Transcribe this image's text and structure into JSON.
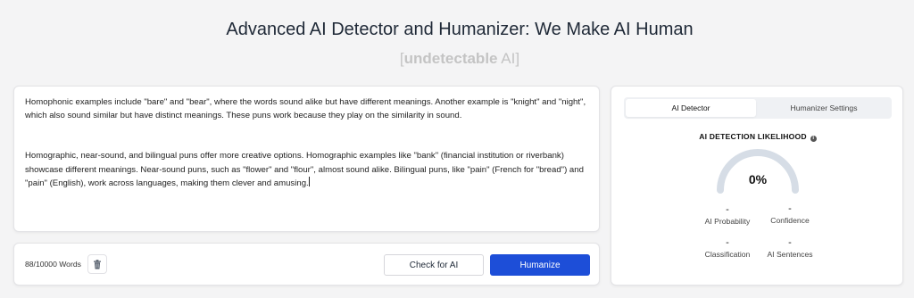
{
  "header": {
    "title": "Advanced AI Detector and Humanizer: We Make AI Human",
    "subtitle_open": "[",
    "subtitle_brand_a": "undetectable",
    "subtitle_brand_b": " AI",
    "subtitle_close": "]"
  },
  "editor": {
    "paragraphs": [
      "Homophonic examples include \"bare\" and \"bear\", where the words sound alike but have different meanings. Another example is \"knight\" and \"night\", which also sound similar but have distinct meanings. These puns work because they play on the similarity in sound.",
      "Homographic, near-sound, and bilingual puns offer more creative options. Homographic examples like \"bank\" (financial institution or riverbank) showcase different meanings. Near-sound puns, such as \"flower\" and \"flour\", almost sound alike. Bilingual puns, like \"pain\" (French for \"bread\") and \"pain\" (English), work across languages, making them clever and amusing."
    ]
  },
  "actions": {
    "word_count": "88/10000 Words",
    "trash_icon": "trash-icon",
    "check_label": "Check for AI",
    "humanize_label": "Humanize"
  },
  "detector": {
    "tabs": [
      {
        "label": "AI Detector",
        "active": true
      },
      {
        "label": "Humanizer Settings",
        "active": false
      }
    ],
    "heading": "AI DETECTION LIKELIHOOD",
    "info_icon": "info-icon",
    "gauge_value": "0%",
    "gauge_level": 0,
    "metrics": {
      "probability": {
        "value": "-",
        "label": "AI Probability"
      },
      "confidence": {
        "value": "-",
        "label": "Confidence"
      },
      "classification": {
        "value": "-",
        "label": "Classification"
      },
      "sentences": {
        "value": "-",
        "label": "AI Sentences"
      }
    }
  },
  "colors": {
    "primary": "#1d4ed8",
    "gauge_track": "#d6dde6",
    "subtitle": "#c4c4c4",
    "background": "#f4f4f5"
  }
}
